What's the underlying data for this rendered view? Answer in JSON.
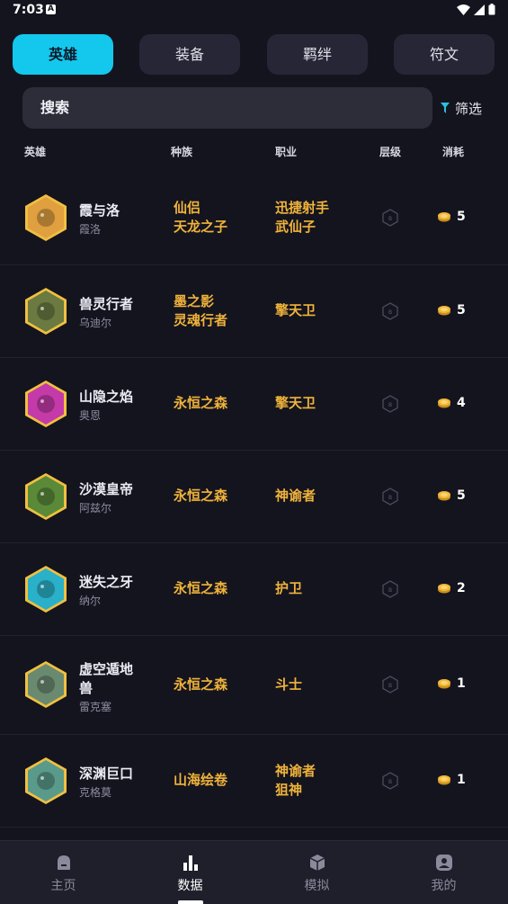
{
  "status": {
    "time": "7:03",
    "notif_icon": "a-icon"
  },
  "tabs": [
    {
      "label": "英雄",
      "active": true
    },
    {
      "label": "装备"
    },
    {
      "label": "羁绊"
    },
    {
      "label": "符文"
    }
  ],
  "search": {
    "placeholder": "搜索"
  },
  "filter": {
    "label": "筛选"
  },
  "columns": {
    "hero": "英雄",
    "race": "种族",
    "class": "职业",
    "tier": "层级",
    "cost": "消耗"
  },
  "heroes": [
    {
      "name": "霞与洛",
      "sub": "霞洛",
      "race": [
        "仙侣",
        "天龙之子"
      ],
      "class": [
        "迅捷射手",
        "武仙子"
      ],
      "tier": "B",
      "cost": "5",
      "color": "#e0a040"
    },
    {
      "name": "兽灵行者",
      "sub": "乌迪尔",
      "race": [
        "墨之影",
        "灵魂行者"
      ],
      "class": [
        "擎天卫"
      ],
      "tier": "B",
      "cost": "5",
      "color": "#6a7a40"
    },
    {
      "name": "山隐之焰",
      "sub": "奥恩",
      "race": [
        "永恒之森"
      ],
      "class": [
        "擎天卫"
      ],
      "tier": "B",
      "cost": "4",
      "color": "#c43aa8"
    },
    {
      "name": "沙漠皇帝",
      "sub": "阿兹尔",
      "race": [
        "永恒之森"
      ],
      "class": [
        "神谕者"
      ],
      "tier": "B",
      "cost": "5",
      "color": "#5a8a38"
    },
    {
      "name": "迷失之牙",
      "sub": "纳尔",
      "race": [
        "永恒之森"
      ],
      "class": [
        "护卫"
      ],
      "tier": "B",
      "cost": "2",
      "color": "#2ab0c8"
    },
    {
      "name": "虚空遁地兽",
      "sub": "雷克塞",
      "race": [
        "永恒之森"
      ],
      "class": [
        "斗士"
      ],
      "tier": "B",
      "cost": "1",
      "color": "#6a8a70"
    },
    {
      "name": "深渊巨口",
      "sub": "克格莫",
      "race": [
        "山海绘卷"
      ],
      "class": [
        "神谕者",
        "狙神"
      ],
      "tier": "B",
      "cost": "1",
      "color": "#5a9a8a"
    }
  ],
  "nav": [
    {
      "label": "主页",
      "icon": "home-icon"
    },
    {
      "label": "数据",
      "icon": "bar-chart-icon",
      "active": true
    },
    {
      "label": "模拟",
      "icon": "cube-icon"
    },
    {
      "label": "我的",
      "icon": "profile-icon"
    }
  ]
}
